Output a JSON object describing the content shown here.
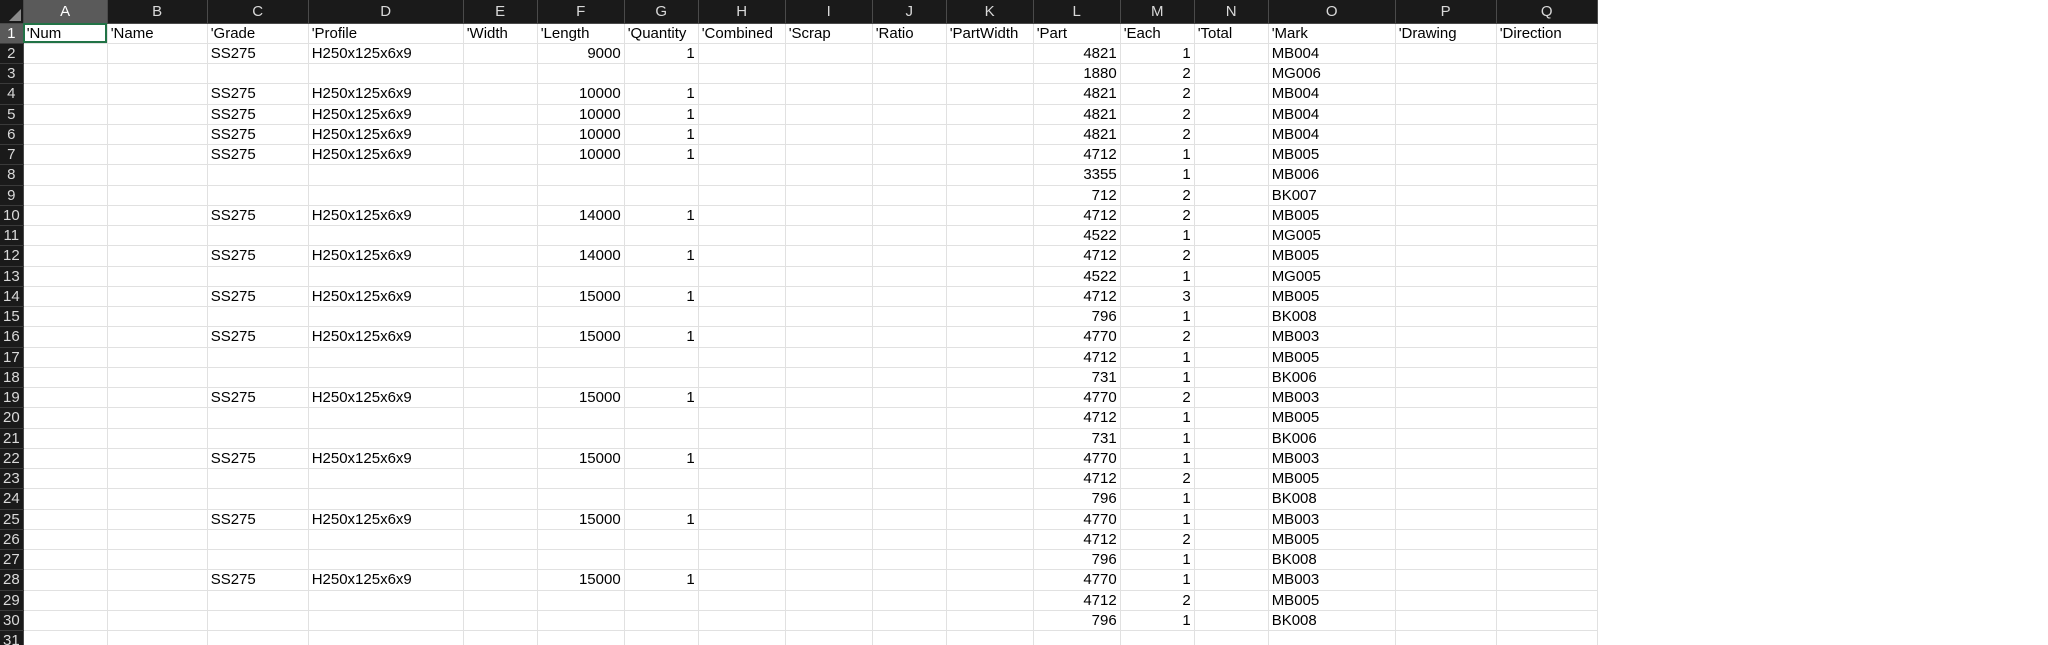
{
  "sheet": {
    "columns": [
      "A",
      "B",
      "C",
      "D",
      "E",
      "F",
      "G",
      "H",
      "I",
      "J",
      "K",
      "L",
      "M",
      "N",
      "O",
      "P",
      "Q"
    ],
    "active_cell": "A1",
    "header_row": [
      "'Num",
      "'Name",
      "'Grade",
      "'Profile",
      "'Width",
      "'Length",
      "'Quantity",
      "'Combined",
      "'Scrap",
      "'Ratio",
      "'PartWidth",
      "'Part",
      "'Each",
      "'Total",
      "'Mark",
      "'Drawing",
      "'Direction"
    ],
    "rows": [
      [
        "",
        "",
        "SS275",
        "H250x125x6x9",
        "",
        "9000",
        "1",
        "",
        "",
        "",
        "",
        "4821",
        "1",
        "",
        "MB004",
        "",
        ""
      ],
      [
        "",
        "",
        "",
        "",
        "",
        "",
        "",
        "",
        "",
        "",
        "",
        "1880",
        "2",
        "",
        "MG006",
        "",
        ""
      ],
      [
        "",
        "",
        "SS275",
        "H250x125x6x9",
        "",
        "10000",
        "1",
        "",
        "",
        "",
        "",
        "4821",
        "2",
        "",
        "MB004",
        "",
        ""
      ],
      [
        "",
        "",
        "SS275",
        "H250x125x6x9",
        "",
        "10000",
        "1",
        "",
        "",
        "",
        "",
        "4821",
        "2",
        "",
        "MB004",
        "",
        ""
      ],
      [
        "",
        "",
        "SS275",
        "H250x125x6x9",
        "",
        "10000",
        "1",
        "",
        "",
        "",
        "",
        "4821",
        "2",
        "",
        "MB004",
        "",
        ""
      ],
      [
        "",
        "",
        "SS275",
        "H250x125x6x9",
        "",
        "10000",
        "1",
        "",
        "",
        "",
        "",
        "4712",
        "1",
        "",
        "MB005",
        "",
        ""
      ],
      [
        "",
        "",
        "",
        "",
        "",
        "",
        "",
        "",
        "",
        "",
        "",
        "3355",
        "1",
        "",
        "MB006",
        "",
        ""
      ],
      [
        "",
        "",
        "",
        "",
        "",
        "",
        "",
        "",
        "",
        "",
        "",
        "712",
        "2",
        "",
        "BK007",
        "",
        ""
      ],
      [
        "",
        "",
        "SS275",
        "H250x125x6x9",
        "",
        "14000",
        "1",
        "",
        "",
        "",
        "",
        "4712",
        "2",
        "",
        "MB005",
        "",
        ""
      ],
      [
        "",
        "",
        "",
        "",
        "",
        "",
        "",
        "",
        "",
        "",
        "",
        "4522",
        "1",
        "",
        "MG005",
        "",
        ""
      ],
      [
        "",
        "",
        "SS275",
        "H250x125x6x9",
        "",
        "14000",
        "1",
        "",
        "",
        "",
        "",
        "4712",
        "2",
        "",
        "MB005",
        "",
        ""
      ],
      [
        "",
        "",
        "",
        "",
        "",
        "",
        "",
        "",
        "",
        "",
        "",
        "4522",
        "1",
        "",
        "MG005",
        "",
        ""
      ],
      [
        "",
        "",
        "SS275",
        "H250x125x6x9",
        "",
        "15000",
        "1",
        "",
        "",
        "",
        "",
        "4712",
        "3",
        "",
        "MB005",
        "",
        ""
      ],
      [
        "",
        "",
        "",
        "",
        "",
        "",
        "",
        "",
        "",
        "",
        "",
        "796",
        "1",
        "",
        "BK008",
        "",
        ""
      ],
      [
        "",
        "",
        "SS275",
        "H250x125x6x9",
        "",
        "15000",
        "1",
        "",
        "",
        "",
        "",
        "4770",
        "2",
        "",
        "MB003",
        "",
        ""
      ],
      [
        "",
        "",
        "",
        "",
        "",
        "",
        "",
        "",
        "",
        "",
        "",
        "4712",
        "1",
        "",
        "MB005",
        "",
        ""
      ],
      [
        "",
        "",
        "",
        "",
        "",
        "",
        "",
        "",
        "",
        "",
        "",
        "731",
        "1",
        "",
        "BK006",
        "",
        ""
      ],
      [
        "",
        "",
        "SS275",
        "H250x125x6x9",
        "",
        "15000",
        "1",
        "",
        "",
        "",
        "",
        "4770",
        "2",
        "",
        "MB003",
        "",
        ""
      ],
      [
        "",
        "",
        "",
        "",
        "",
        "",
        "",
        "",
        "",
        "",
        "",
        "4712",
        "1",
        "",
        "MB005",
        "",
        ""
      ],
      [
        "",
        "",
        "",
        "",
        "",
        "",
        "",
        "",
        "",
        "",
        "",
        "731",
        "1",
        "",
        "BK006",
        "",
        ""
      ],
      [
        "",
        "",
        "SS275",
        "H250x125x6x9",
        "",
        "15000",
        "1",
        "",
        "",
        "",
        "",
        "4770",
        "1",
        "",
        "MB003",
        "",
        ""
      ],
      [
        "",
        "",
        "",
        "",
        "",
        "",
        "",
        "",
        "",
        "",
        "",
        "4712",
        "2",
        "",
        "MB005",
        "",
        ""
      ],
      [
        "",
        "",
        "",
        "",
        "",
        "",
        "",
        "",
        "",
        "",
        "",
        "796",
        "1",
        "",
        "BK008",
        "",
        ""
      ],
      [
        "",
        "",
        "SS275",
        "H250x125x6x9",
        "",
        "15000",
        "1",
        "",
        "",
        "",
        "",
        "4770",
        "1",
        "",
        "MB003",
        "",
        ""
      ],
      [
        "",
        "",
        "",
        "",
        "",
        "",
        "",
        "",
        "",
        "",
        "",
        "4712",
        "2",
        "",
        "MB005",
        "",
        ""
      ],
      [
        "",
        "",
        "",
        "",
        "",
        "",
        "",
        "",
        "",
        "",
        "",
        "796",
        "1",
        "",
        "BK008",
        "",
        ""
      ],
      [
        "",
        "",
        "SS275",
        "H250x125x6x9",
        "",
        "15000",
        "1",
        "",
        "",
        "",
        "",
        "4770",
        "1",
        "",
        "MB003",
        "",
        ""
      ],
      [
        "",
        "",
        "",
        "",
        "",
        "",
        "",
        "",
        "",
        "",
        "",
        "4712",
        "2",
        "",
        "MB005",
        "",
        ""
      ],
      [
        "",
        "",
        "",
        "",
        "",
        "",
        "",
        "",
        "",
        "",
        "",
        "796",
        "1",
        "",
        "BK008",
        "",
        ""
      ],
      [
        "",
        "",
        "",
        "",
        "",
        "",
        "",
        "",
        "",
        "",
        "",
        "",
        "",
        "",
        "",
        "",
        ""
      ]
    ],
    "numeric_columns": [
      5,
      6,
      11,
      12
    ],
    "colors": {
      "header_bg": "#1a1a1a",
      "header_text": "#d9d9d9",
      "active_header_bg": "#5a5a5a",
      "gridline": "#e1e1e1",
      "selection": "#217346"
    }
  }
}
